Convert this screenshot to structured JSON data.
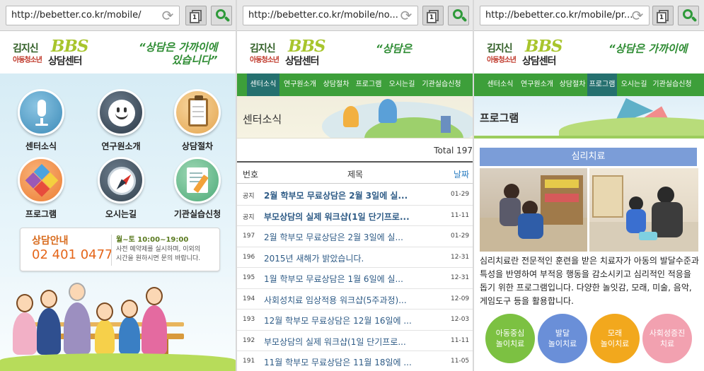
{
  "browser": {
    "screen1_url": "http://bebetter.co.kr/mobile/",
    "screen2_url": "http://bebetter.co.kr/mobile/no...",
    "screen3_url": "http://bebetter.co.kr/mobile/pr...",
    "tabs_count": "1",
    "reload_icon": "reload-icon",
    "search_icon": "search-icon"
  },
  "site": {
    "logo_line1": "김지신",
    "logo_line2": "아동청소년",
    "logo_bbs": "BBS",
    "logo_line3": "상담센터",
    "slogan1_a": "“상담은 가까이에",
    "slogan1_b": "있습니다”",
    "slogan2": "“상담은",
    "slogan3": "“상담은 가까이에"
  },
  "home": {
    "menu": [
      {
        "label": "센터소식",
        "icon": "microphone-icon"
      },
      {
        "label": "연구원소개",
        "icon": "smile-icon"
      },
      {
        "label": "상담절차",
        "icon": "clipboard-icon"
      },
      {
        "label": "프로그램",
        "icon": "puzzle-icon"
      },
      {
        "label": "오시는길",
        "icon": "compass-icon"
      },
      {
        "label": "기관실습신청",
        "icon": "pencil-icon"
      }
    ],
    "info": {
      "title": "상담안내",
      "phone": "02 401 0477",
      "hours": "월~토 10:00~19:00",
      "desc1": "사전 예약제를 실시하며, 이외의",
      "desc2": "시간을 원하시면 문의 바랍니다."
    }
  },
  "nav": {
    "items": [
      "센터소식",
      "연구원소개",
      "상담절차",
      "프로그램",
      "오시는길",
      "기관실습신청"
    ]
  },
  "news": {
    "banner_title": "센터소식",
    "total": "Total 197",
    "headers": {
      "no": "번호",
      "subject": "제목",
      "date": "날짜"
    },
    "rows": [
      {
        "no": "공지",
        "subject": "2월 학부모 무료상담은 2월 3일에 실...",
        "date": "01-29"
      },
      {
        "no": "공지",
        "subject": "부모상담의 실제 워크샵(1일 단기프로...",
        "date": "11-11"
      },
      {
        "no": "197",
        "subject": "2월 학부모 무료상담은 2월 3일에 실...",
        "date": "01-29"
      },
      {
        "no": "196",
        "subject": "2015년 새해가 밝았습니다.",
        "date": "12-31"
      },
      {
        "no": "195",
        "subject": "1월 학부모 무료상담은 1월 6일에 실...",
        "date": "12-31"
      },
      {
        "no": "194",
        "subject": "사회성치료 임상적용 워크샵(5주과정)...",
        "date": "12-09"
      },
      {
        "no": "193",
        "subject": "12월 학부모 무료상담은 12월 16일에 ...",
        "date": "12-03"
      },
      {
        "no": "192",
        "subject": "부모상담의 실제 워크샵(1일 단기프로...",
        "date": "11-11"
      },
      {
        "no": "191",
        "subject": "11월 학부모 무료상담은 11월 18일에 ...",
        "date": "11-05"
      }
    ]
  },
  "program": {
    "banner_title": "프로그램",
    "section_title": "심리치료",
    "description": "심리치료란 전문적인 훈련을 받은 치료자가 아동의 발달수준과 특성을 반영하여 부적응 행동을 감소시키고 심리적인 적응을 돕기 위한 프로그램입니다. 다양한 놀잇감, 모래, 미술, 음악, 게임도구 등을 활용합니다.",
    "bubbles": [
      {
        "line1": "아동중심",
        "line2": "놀이치료",
        "color": "#7cc142"
      },
      {
        "line1": "발달",
        "line2": "놀이치료",
        "color": "#6a8fd8"
      },
      {
        "line1": "모래",
        "line2": "놀이치료",
        "color": "#f2a81d"
      },
      {
        "line1": "사회성증진",
        "line2": "치료",
        "color": "#f2a1b0"
      }
    ]
  },
  "colors": {
    "nav_green": "#3d9f3a",
    "nav_active": "#25706f",
    "phone_orange": "#e5661a",
    "link_blue": "#2e5b86"
  }
}
